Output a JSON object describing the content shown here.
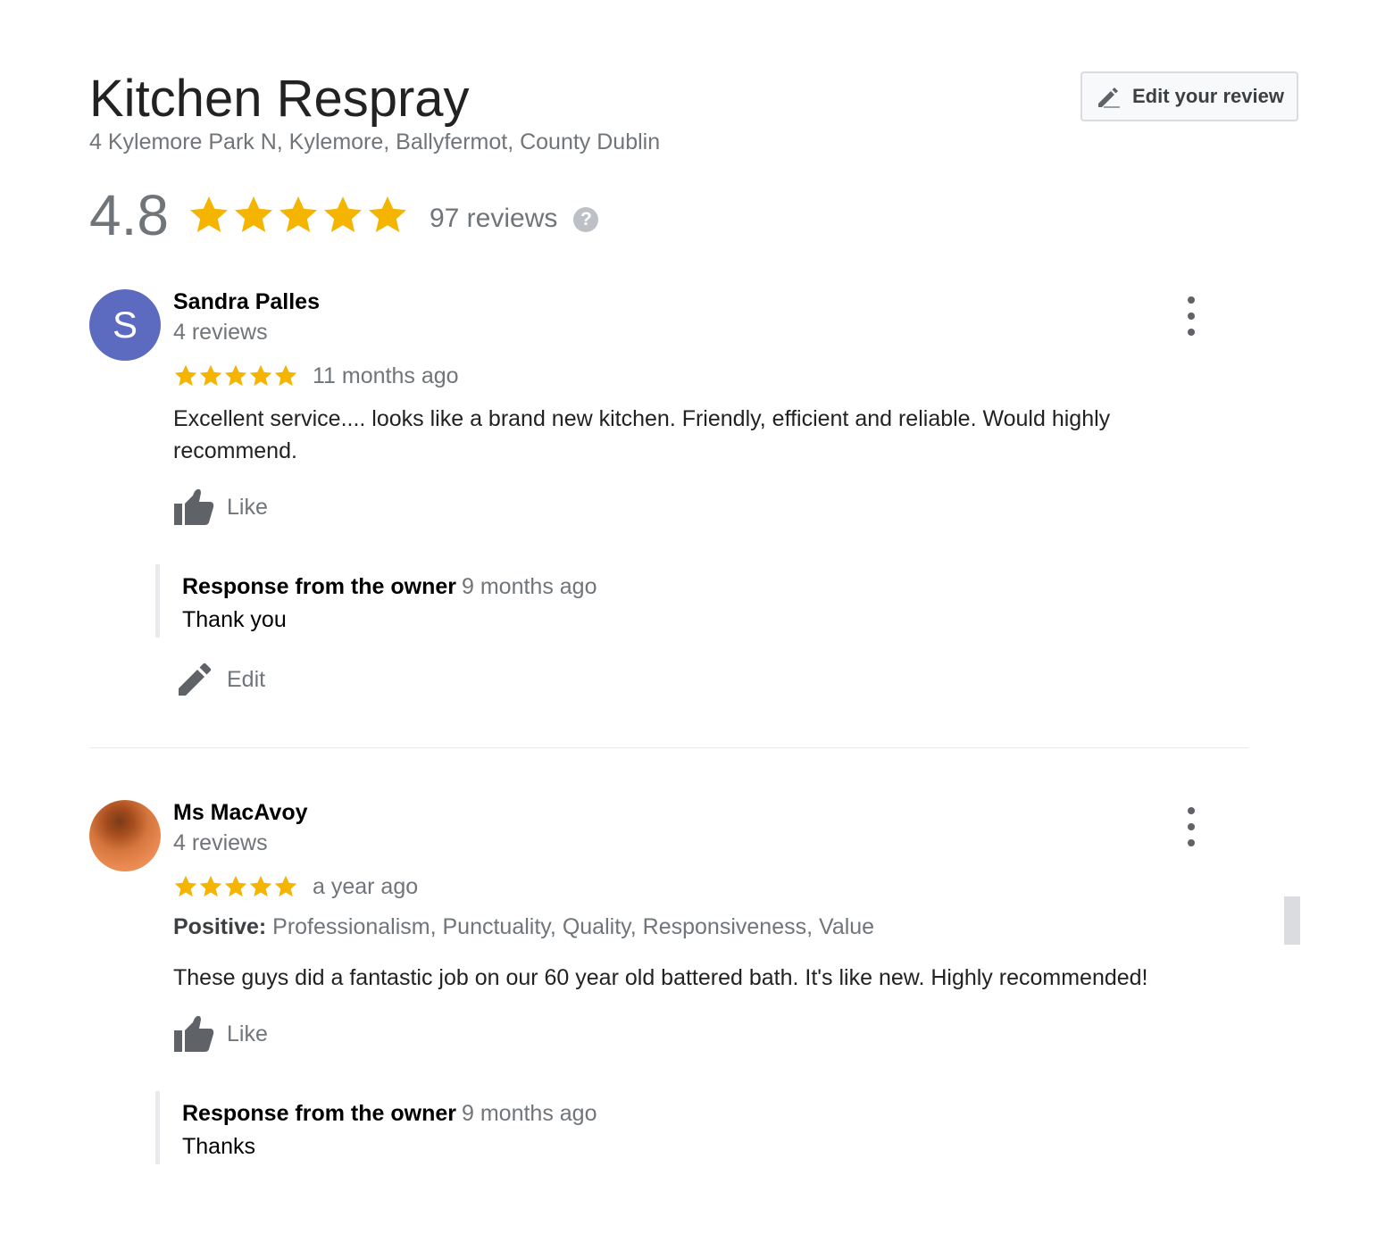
{
  "business": {
    "name": "Kitchen Respray",
    "address": "4 Kylemore Park N, Kylemore, Ballyfermot, County Dublin",
    "rating": "4.8",
    "rating_stars": 5,
    "review_count": "97 reviews",
    "help_icon": "?"
  },
  "actions": {
    "edit_your_review": "Edit your review"
  },
  "colors": {
    "star": "#f4b400",
    "avatar_letter_bg": "#5c6bc0"
  },
  "reviews": [
    {
      "avatar_letter": "S",
      "name": "Sandra Palles",
      "meta": "4 reviews",
      "stars": 5,
      "date": "11 months ago",
      "text": "Excellent service.... looks like a brand new kitchen. Friendly, efficient and reliable. Would highly recommend.",
      "like_label": "Like",
      "response": {
        "heading": "Response from the owner",
        "date": "9 months ago",
        "text": "Thank you"
      },
      "edit_label": "Edit"
    },
    {
      "avatar_letter": "",
      "name": "Ms MacAvoy",
      "meta": "4 reviews",
      "stars": 5,
      "date": "a year ago",
      "tags_label": "Positive:",
      "tags": "Professionalism, Punctuality, Quality, Responsiveness, Value",
      "text": "These guys did a fantastic job on our 60 year old battered bath. It's like new. Highly recommended!",
      "like_label": "Like",
      "response": {
        "heading": "Response from the owner",
        "date": "9 months ago",
        "text": "Thanks"
      }
    }
  ]
}
